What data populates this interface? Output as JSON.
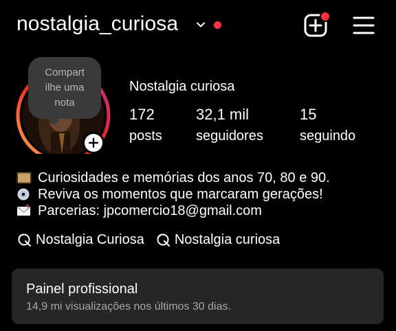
{
  "header": {
    "username": "nostalgia_curiosa",
    "icons": {
      "account_switch": "chevron-down-icon",
      "notification": "red-dot",
      "create": "plus-square-icon",
      "menu": "hamburger-menu-icon"
    },
    "accent_color": "#ff3040"
  },
  "profile": {
    "note_text": "Compartilhe uma nota",
    "note_lines": [
      "Compart",
      "ilhe uma",
      "nota"
    ],
    "display_name": "Nostalgia curiosa",
    "stats": [
      {
        "value": "172",
        "label": "posts"
      },
      {
        "value": "32,1 mil",
        "label": "seguidores"
      },
      {
        "value": "15",
        "label": "seguindo"
      }
    ],
    "ring_colors": [
      "#fcaf45",
      "#fd1d1d",
      "#c13584"
    ]
  },
  "bio": {
    "lines": [
      {
        "icon": "film-frame-icon",
        "text": "Curiosidades e memórias dos anos 70, 80 e 90."
      },
      {
        "icon": "cd-disc-icon",
        "text": "Reviva os momentos que marcaram gerações!"
      },
      {
        "icon": "envelope-icon",
        "text": "Parcerias: jpcomercio18@gmail.com"
      }
    ]
  },
  "links": [
    {
      "icon": "threads-icon",
      "label": "Nostalgia Curiosa"
    },
    {
      "icon": "threads-icon",
      "label": "Nostalgia curiosa"
    }
  ],
  "professional_panel": {
    "title": "Painel profissional",
    "subtitle": "14,9 mi visualizações nos últimos 30 dias."
  }
}
